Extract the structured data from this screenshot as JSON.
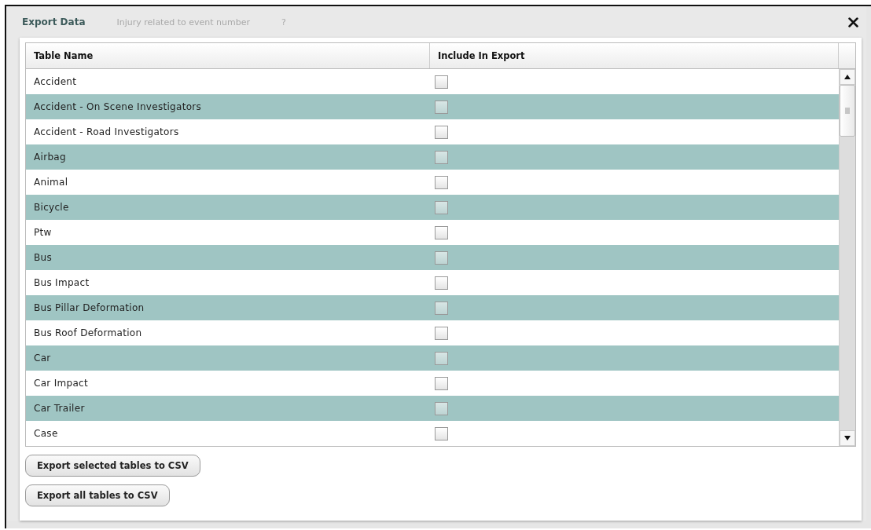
{
  "dialog": {
    "title": "Export Data",
    "background_text": [
      "Injury related to event number",
      "?"
    ]
  },
  "table": {
    "columns": [
      "Table Name",
      "Include In Export"
    ],
    "rows": [
      {
        "name": "Accident",
        "checked": false
      },
      {
        "name": "Accident - On Scene Investigators",
        "checked": false
      },
      {
        "name": "Accident - Road Investigators",
        "checked": false
      },
      {
        "name": "Airbag",
        "checked": false
      },
      {
        "name": "Animal",
        "checked": false
      },
      {
        "name": "Bicycle",
        "checked": false
      },
      {
        "name": "Ptw",
        "checked": false
      },
      {
        "name": "Bus",
        "checked": false
      },
      {
        "name": "Bus Impact",
        "checked": false
      },
      {
        "name": "Bus Pillar Deformation",
        "checked": false
      },
      {
        "name": "Bus Roof Deformation",
        "checked": false
      },
      {
        "name": "Car",
        "checked": false
      },
      {
        "name": "Car Impact",
        "checked": false
      },
      {
        "name": "Car Trailer",
        "checked": false
      },
      {
        "name": "Case",
        "checked": false
      }
    ]
  },
  "buttons": [
    "Export selected tables to CSV",
    "Export all tables to CSV"
  ]
}
